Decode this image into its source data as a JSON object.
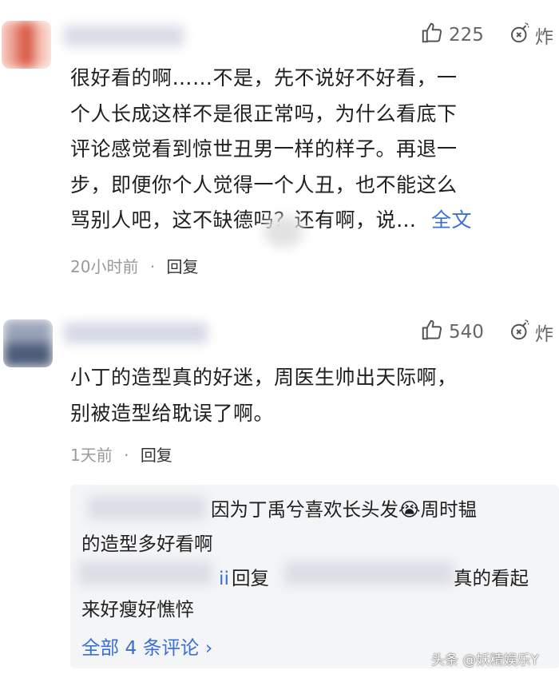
{
  "comment1": {
    "likes": "225",
    "bomb_label": "炸",
    "lines": [
      "很好看的啊……不是，先不说好不好看，一",
      "个人长成这样不是很正常吗，为什么看底下",
      "评论感觉看到惊世丑男一样的样子。再退一",
      "步，即便你个人觉得一个人丑，也不能这么",
      "骂别人吧，这不缺德吗？还有啊，说…"
    ],
    "more_label": "全文",
    "time": "20小时前",
    "dot": "·",
    "reply_label": "回复"
  },
  "comment2": {
    "likes": "540",
    "bomb_label": "炸",
    "lines": [
      "小丁的造型真的好迷，周医生帅出天际啊，",
      "别被造型给耽误了啊。"
    ],
    "time": "1天前",
    "dot": "·",
    "reply_label": "回复",
    "replies": {
      "reply1_line1": "因为丁禹兮喜欢长头发",
      "reply1_emoji": "😭",
      "reply1_line1_end": "周时韫",
      "reply1_line2": "的造型多好看啊",
      "reply2_prefix": "ii",
      "reply2_verb": "回复",
      "reply2_line1_end": "真的看起",
      "reply2_line2": "来好瘦好憔悴",
      "all_comments": "全部 4 条评论 ›"
    }
  },
  "watermark": "头条 @妖精娱乐Y"
}
